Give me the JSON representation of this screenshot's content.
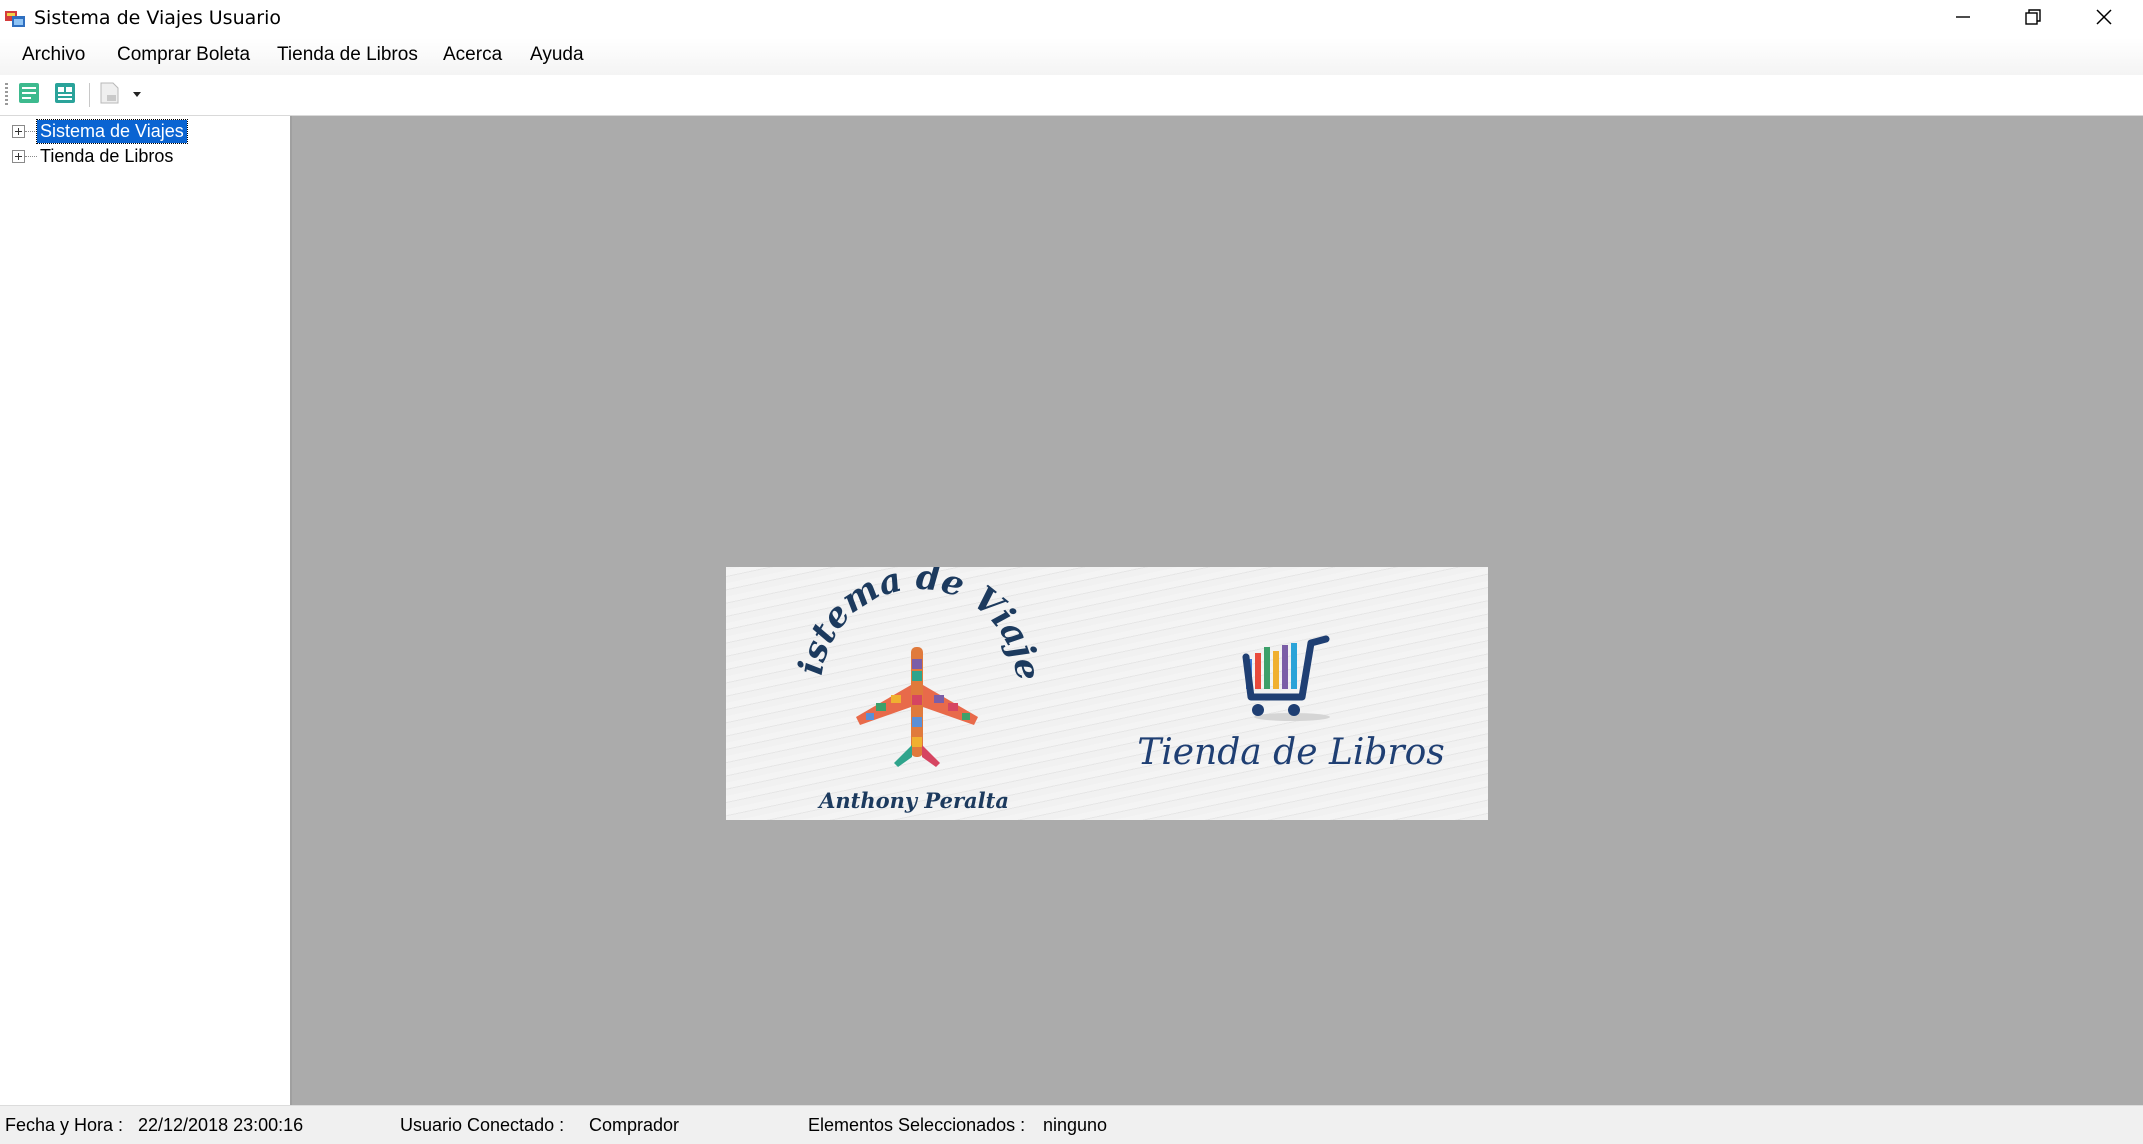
{
  "window": {
    "title": "Sistema de Viajes Usuario",
    "controls": [
      "minimize-icon",
      "restore-icon",
      "close-icon"
    ]
  },
  "menu": {
    "items": [
      "Archivo",
      "Comprar Boleta",
      "Tienda de Libros",
      "Acerca",
      "Ayuda"
    ]
  },
  "toolbar": {
    "buttons": [
      "list-green-icon",
      "list-teal-icon",
      "document-dropdown-icon"
    ]
  },
  "tree": {
    "nodes": [
      {
        "label": "Sistema de Viajes",
        "selected": true
      },
      {
        "label": "Tienda de Libros",
        "selected": false
      }
    ]
  },
  "banner": {
    "left_arc_text": "Sistema de Viajes",
    "left_author": "Anthony Peralta",
    "right_title": "Tienda de Libros",
    "colors": {
      "navy": "#1c3a5e",
      "cart_blue": "#1f3f73"
    }
  },
  "status": {
    "datetime_label": "Fecha y Hora :",
    "datetime_value": "22/12/2018 23:00:16",
    "user_label": "Usuario Conectado :",
    "user_value": "Comprador",
    "selected_label": "Elementos Seleccionados :",
    "selected_value": "ninguno"
  }
}
